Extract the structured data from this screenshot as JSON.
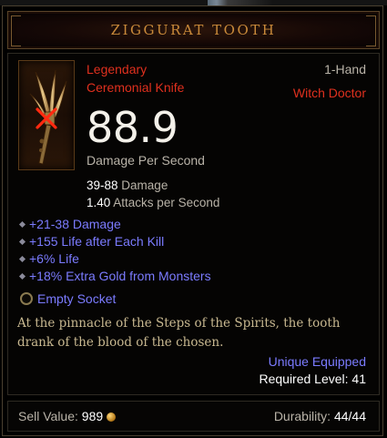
{
  "item": {
    "name": "ZIGGURAT TOOTH",
    "quality": "Legendary",
    "type": "Ceremonial Knife",
    "slot": "1-Hand",
    "class_requirement": "Witch Doctor",
    "dps_value": "88.9",
    "dps_label": "Damage Per Second",
    "damage_range": "39-88",
    "damage_label": "Damage",
    "attack_speed": "1.40",
    "attack_speed_label": "Attacks per Second",
    "icon": "ceremonial-knife-icon"
  },
  "affixes": [
    "+21-38 Damage",
    "+155 Life after Each Kill",
    "+6% Life",
    "+18% Extra Gold from Monsters"
  ],
  "socket": {
    "label": "Empty Socket",
    "icon": "socket-icon"
  },
  "flavor_text": "At the pinnacle of the Steps of the Spirits, the tooth drank of the blood of the chosen.",
  "restrictions": {
    "unique_equipped": "Unique Equipped",
    "required_level_label": "Required Level:",
    "required_level": "41"
  },
  "footer": {
    "sell_label": "Sell Value:",
    "sell_value": "989",
    "durability_label": "Durability:",
    "durability_value": "44/44"
  },
  "colors": {
    "legendary_orange": "#e0301e",
    "title_gold": "#c98a3a",
    "magic_blue": "#7b7bff",
    "background": "#000000"
  }
}
